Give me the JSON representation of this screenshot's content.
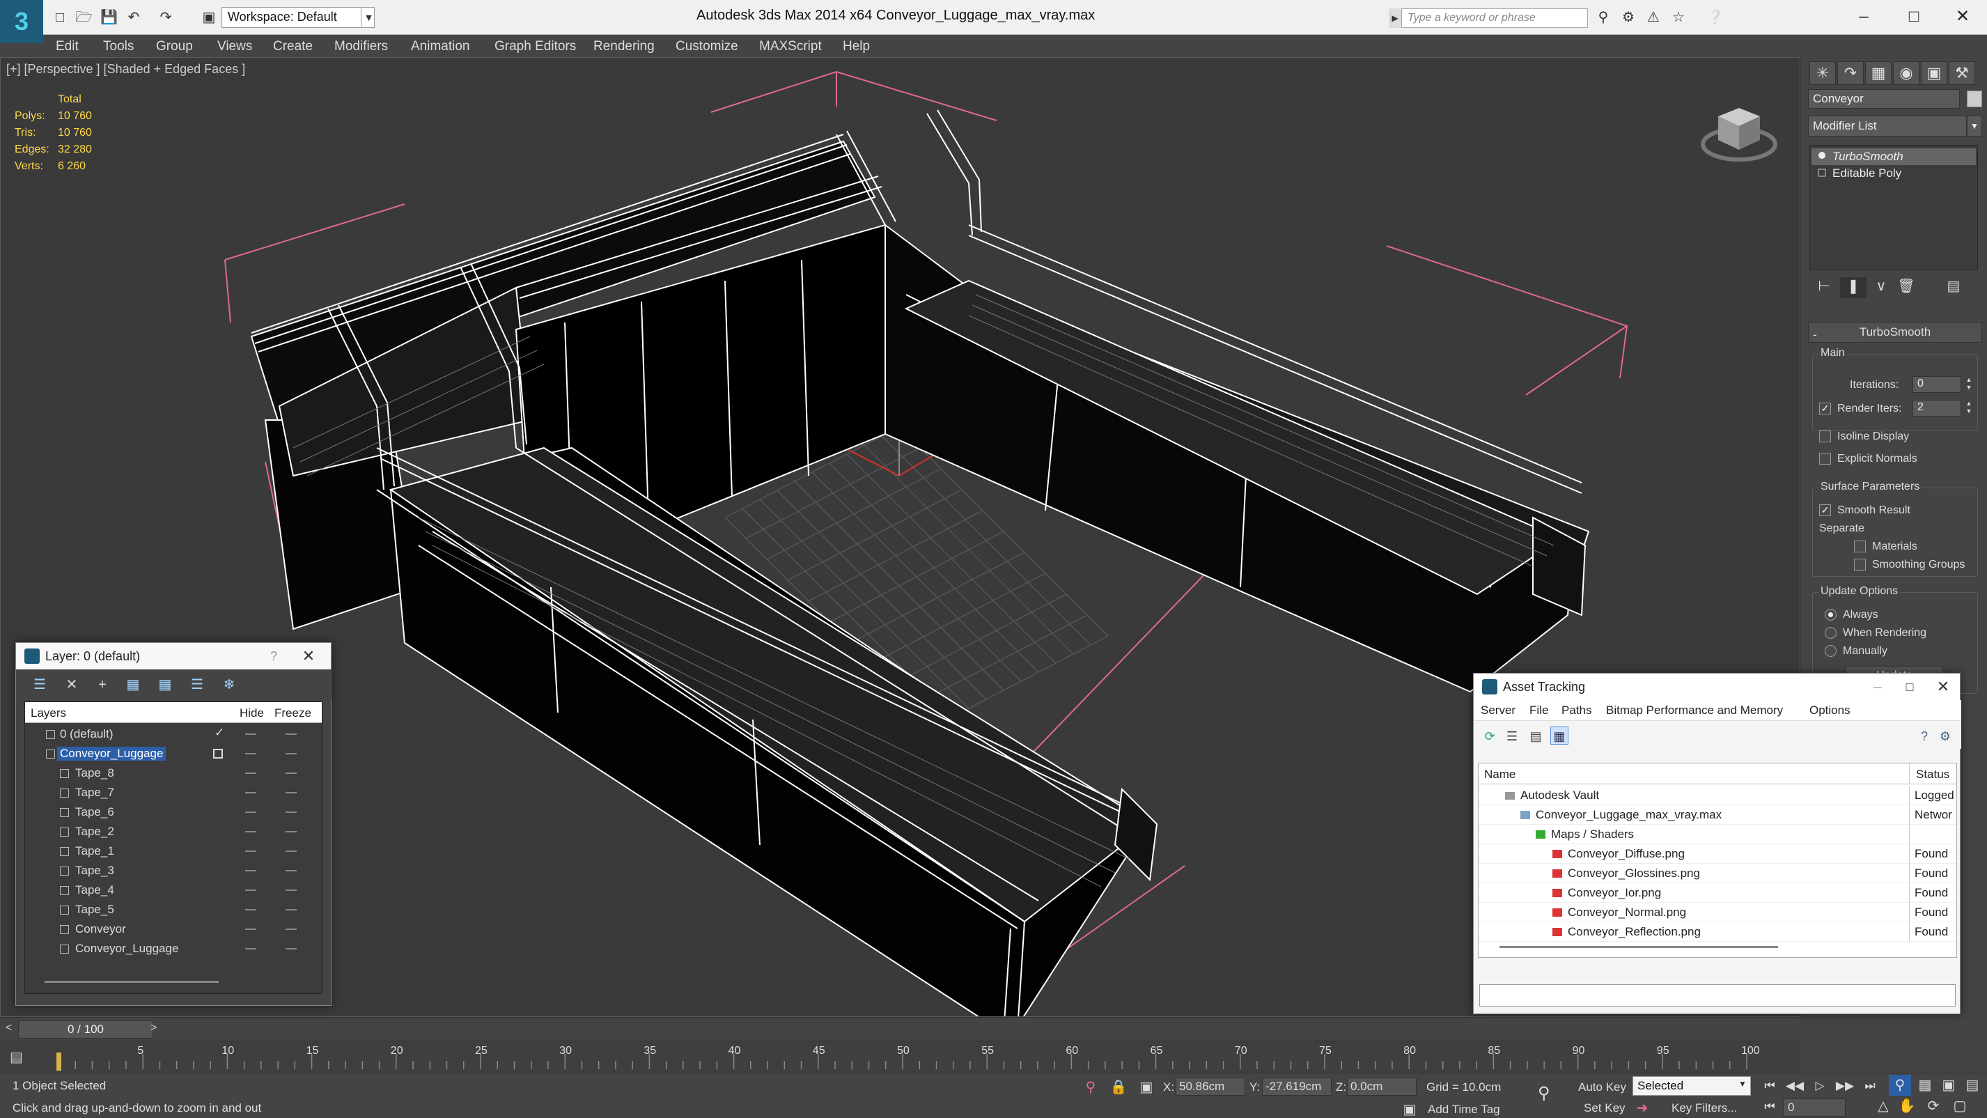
{
  "titlebar": {
    "workspace": "Workspace: Default",
    "app_title": "Autodesk 3ds Max  2014 x64",
    "file_title": "Conveyor_Luggage_max_vray.max",
    "search_placeholder": "Type a keyword or phrase"
  },
  "menu": [
    "Edit",
    "Tools",
    "Group",
    "Views",
    "Create",
    "Modifiers",
    "Animation",
    "Graph Editors",
    "Rendering",
    "Customize",
    "MAXScript",
    "Help"
  ],
  "viewport": {
    "label": "[+] [Perspective ] [Shaded + Edged Faces ]",
    "stats": {
      "header": "Total",
      "polys_label": "Polys:",
      "polys": "10 760",
      "tris_label": "Tris:",
      "tris": "10 760",
      "edges_label": "Edges:",
      "edges": "32 280",
      "verts_label": "Verts:",
      "verts": "6 260"
    }
  },
  "command_panel": {
    "object_name": "Conveyor",
    "modifier_list": "Modifier List",
    "stack": [
      "TurboSmooth",
      "Editable Poly"
    ],
    "turbosmooth": {
      "title": "TurboSmooth",
      "main": "Main",
      "iterations_label": "Iterations:",
      "iterations": "0",
      "render_iters_label": "Render Iters:",
      "render_iters": "2",
      "isoline": "Isoline Display",
      "explicit_normals": "Explicit Normals",
      "surface_params": "Surface Parameters",
      "smooth_result": "Smooth Result",
      "separate": "Separate",
      "materials": "Materials",
      "smoothing_groups": "Smoothing Groups",
      "update_options": "Update Options",
      "always": "Always",
      "when_rendering": "When Rendering",
      "manually": "Manually",
      "update_button": "Update"
    }
  },
  "layer_dialog": {
    "title": "Layer: 0 (default)",
    "columns": {
      "layers": "Layers",
      "hide": "Hide",
      "freeze": "Freeze"
    },
    "rows": [
      "0 (default)",
      "Conveyor_Luggage",
      "Tape_8",
      "Tape_7",
      "Tape_6",
      "Tape_2",
      "Tape_1",
      "Tape_3",
      "Tape_4",
      "Tape_5",
      "Conveyor",
      "Conveyor_Luggage"
    ]
  },
  "asset_dialog": {
    "title": "Asset Tracking",
    "menu": [
      "Server",
      "File",
      "Paths",
      "Bitmap Performance and Memory",
      "Options"
    ],
    "columns": {
      "name": "Name",
      "status": "Status"
    },
    "rows": [
      {
        "name": "Autodesk Vault",
        "status": "Logged"
      },
      {
        "name": "Conveyor_Luggage_max_vray.max",
        "status": "Networ"
      },
      {
        "name": "Maps / Shaders",
        "status": ""
      },
      {
        "name": "Conveyor_Diffuse.png",
        "status": "Found"
      },
      {
        "name": "Conveyor_Glossines.png",
        "status": "Found"
      },
      {
        "name": "Conveyor_Ior.png",
        "status": "Found"
      },
      {
        "name": "Conveyor_Normal.png",
        "status": "Found"
      },
      {
        "name": "Conveyor_Reflection.png",
        "status": "Found"
      }
    ]
  },
  "timeline": {
    "frame_display": "0 / 100",
    "ticks": [
      "5",
      "10",
      "15",
      "20",
      "25",
      "30",
      "35",
      "40",
      "45",
      "50",
      "55",
      "60",
      "65",
      "70",
      "75",
      "80",
      "85",
      "90",
      "95",
      "100"
    ]
  },
  "status": {
    "selection": "1 Object Selected",
    "prompt": "Click and drag up-and-down to zoom in and out",
    "x_label": "X:",
    "x": "50.86cm",
    "y_label": "Y:",
    "y": "-27.619cm",
    "z_label": "Z:",
    "z": "0.0cm",
    "grid": "Grid = 10.0cm",
    "add_time_tag": "Add Time Tag",
    "auto_key": "Auto Key",
    "set_key": "Set Key",
    "selected_dd": "Selected",
    "key_filters": "Key Filters...",
    "frame": "0"
  },
  "colors": {
    "accent_blue": "#2c5fa8",
    "stats_yellow": "#ffd84a",
    "selection_pink": "#e06a8c",
    "wire_white": "#ffffff"
  }
}
